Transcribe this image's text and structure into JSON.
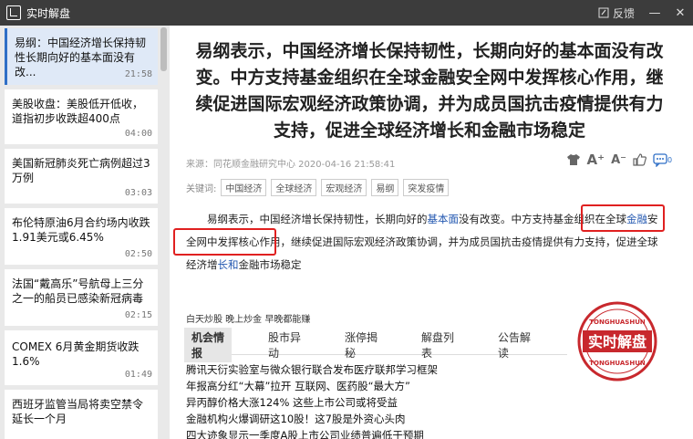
{
  "window": {
    "title": "实时解盘",
    "feedback": "反馈"
  },
  "sidebar": {
    "items": [
      {
        "text": "易纲：中国经济增长保持韧性长期向好的基本面没有改...",
        "time": "21:58"
      },
      {
        "text": "美股收盘：美股低开低收，道指初步收跌超400点",
        "time": "04:00"
      },
      {
        "text": "美国新冠肺炎死亡病例超过3万例",
        "time": "03:03"
      },
      {
        "text": "布伦特原油6月合约场内收跌1.91美元或6.45%",
        "time": "02:50"
      },
      {
        "text": "法国“戴高乐”号航母上三分之一的船员已感染新冠病毒",
        "time": "02:15"
      },
      {
        "text": "COMEX 6月黄金期货收跌1.6%",
        "time": "01:49"
      },
      {
        "text": "西班牙监管当局将卖空禁令延长一个月",
        "time": ""
      }
    ]
  },
  "article": {
    "headline": "易纲表示，中国经济增长保持韧性，长期向好的基本面没有改变。中方支持基金组织在全球金融安全网中发挥核心作用，继续促进国际宏观经济政策协调，并为成员国抗击疫情提供有力支持，促进全球经济增长和金融市场稳定",
    "source": "来源：同花顺金融研究中心  2020-04-16 21:58:41",
    "tags_label": "关键词:",
    "tags": [
      "中国经济",
      "全球经济",
      "宏观经济",
      "易纲",
      "突发疫情"
    ],
    "body_1": "易纲表示，中国经济增长保持韧性，长期向好的",
    "body_link_1": "基本面",
    "body_2": "没有改变。中方支持基金组织在全球",
    "body_link_2": "金融",
    "body_3": "安全网中发挥核心作用，继续促进国际宏观经济政策协调，并为成员国抗击疫情提供有力支持，促进全球经济增",
    "body_link_3": "长和",
    "body_4": "金融市场稳定"
  },
  "subnav": "白天炒股  晚上炒金  早晚都能赚",
  "tabs": [
    "机会情报",
    "股市异动",
    "涨停揭秘",
    "解盘列表",
    "公告解读"
  ],
  "news": [
    "腾讯天衍实验室与微众银行联合发布医疗联邦学习框架",
    "年报高分红“大幕”拉开 互联网、医药股“最大方”",
    "异丙醇价格大涨124% 这些上市公司或将受益",
    "金融机构火爆调研这10股！这7股是外资心头肉",
    "四大迹象显示一季度A股上市公司业绩普遍低于预期"
  ],
  "stamp": {
    "text": "实时解盘",
    "ring": "TONGHUASHUN"
  },
  "colors": {
    "titlebar": "#3c3c3c",
    "link": "#2257b0",
    "highlight_box": "#e02020",
    "active_card": "#dfe9f7"
  }
}
